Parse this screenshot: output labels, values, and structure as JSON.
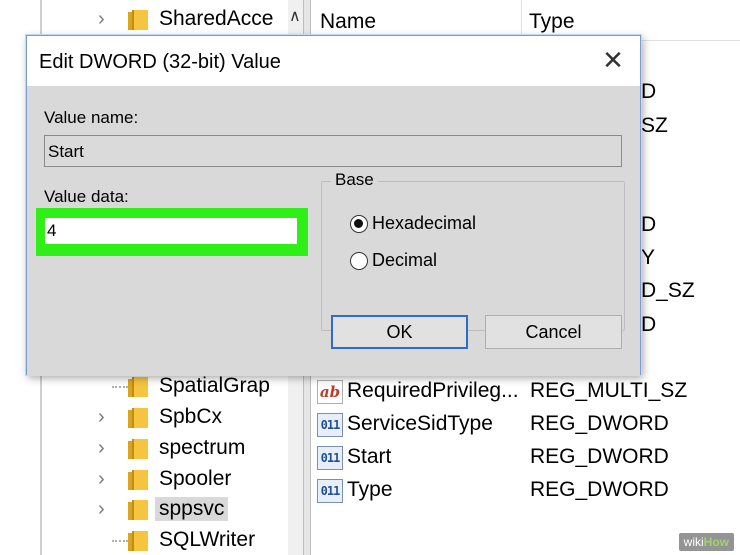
{
  "tree": {
    "items": [
      {
        "label": "SharedAcce"
      },
      {
        "label": "SpatialGrap"
      },
      {
        "label": "SpbCx"
      },
      {
        "label": "spectrum"
      },
      {
        "label": "Spooler"
      },
      {
        "label": "sppsvc"
      },
      {
        "label": "SQLWriter"
      }
    ],
    "scroll_up_glyph": "∧"
  },
  "list": {
    "headers": {
      "name": "Name",
      "type": "Type"
    },
    "peek_types": [
      "D",
      "SZ",
      "D",
      "Y",
      "D_SZ",
      "D"
    ],
    "rows": [
      {
        "name": "RequiredPrivileg...",
        "type": "REG_MULTI_SZ",
        "icon": "string-value-icon"
      },
      {
        "name": "ServiceSidType",
        "type": "REG_DWORD",
        "icon": "binary-value-icon"
      },
      {
        "name": "Start",
        "type": "REG_DWORD",
        "icon": "binary-value-icon"
      },
      {
        "name": "Type",
        "type": "REG_DWORD",
        "icon": "binary-value-icon"
      }
    ],
    "icon_text": {
      "string": "ab",
      "binary": "011"
    }
  },
  "dialog": {
    "title": "Edit DWORD (32-bit) Value",
    "close_glyph": "✕",
    "value_name_label": "Value name:",
    "value_name": "Start",
    "value_data_label": "Value data:",
    "value_data": "4",
    "base_label": "Base",
    "radio_hex": "Hexadecimal",
    "radio_dec": "Decimal",
    "selected_base": "Hexadecimal",
    "ok": "OK",
    "cancel": "Cancel",
    "highlight_color": "#2ef016"
  },
  "watermark": {
    "wiki": "wiki",
    "how": "How"
  }
}
